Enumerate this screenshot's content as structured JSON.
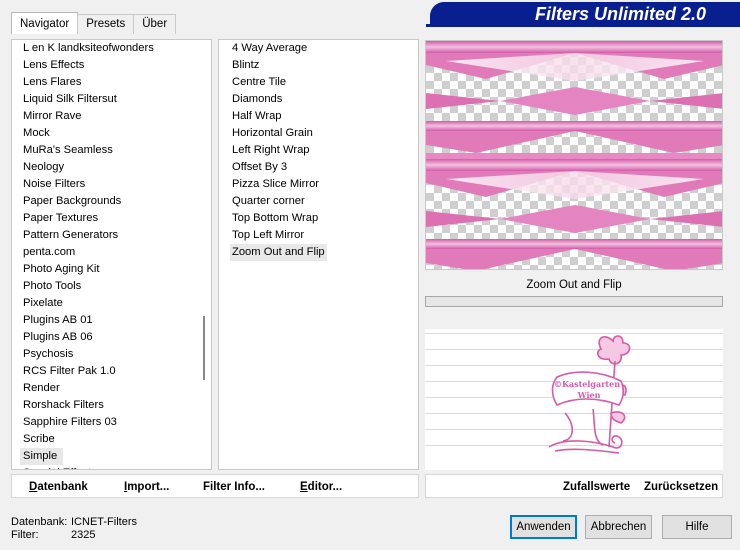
{
  "tabs": [
    {
      "label": "Navigator",
      "active": true
    },
    {
      "label": "Presets",
      "active": false
    },
    {
      "label": "Über",
      "active": false
    }
  ],
  "banner": {
    "title": "Filters Unlimited 2.0"
  },
  "categories": {
    "items": [
      "L en K landksiteofwonders",
      "Lens Effects",
      "Lens Flares",
      "Liquid Silk Filtersut",
      "Mirror Rave",
      "Mock",
      "MuRa's Seamless",
      "Neology",
      "Noise Filters",
      "Paper Backgrounds",
      "Paper Textures",
      "Pattern Generators",
      "penta.com",
      "Photo Aging Kit",
      "Photo Tools",
      "Pixelate",
      "Plugins AB 01",
      "Plugins AB 06",
      "Psychosis",
      "RCS Filter Pak 1.0",
      "Render",
      "Rorshack Filters",
      "Sapphire Filters 03",
      "Scribe",
      "Simple",
      "Special Effects"
    ],
    "selected": "Simple"
  },
  "filters": {
    "items": [
      "4 Way Average",
      "Blintz",
      "Centre Tile",
      "Diamonds",
      "Half Wrap",
      "Horizontal Grain",
      "Left Right Wrap",
      "Offset By 3",
      "Pizza Slice Mirror",
      "Quarter corner",
      "Top Bottom Wrap",
      "Top Left Mirror",
      "Zoom Out and Flip"
    ],
    "selected": "Zoom Out and Flip"
  },
  "preview": {
    "filter_name": "Zoom Out and Flip",
    "accent": "#e070b8"
  },
  "logo": {
    "line1": "©Kastelgarten",
    "line2": "Wien"
  },
  "left_buttons": {
    "database": "Datenbank",
    "import": "Import...",
    "filter_info": "Filter Info...",
    "editor": "Editor..."
  },
  "right_buttons": {
    "random": "Zufallswerte",
    "reset": "Zurücksetzen"
  },
  "status": {
    "database_label": "Datenbank:",
    "database_value": "ICNET-Filters",
    "filter_label": "Filter:",
    "filter_value": "2325"
  },
  "dialog_buttons": {
    "apply": "Anwenden",
    "cancel": "Abbrechen",
    "help": "Hilfe"
  }
}
